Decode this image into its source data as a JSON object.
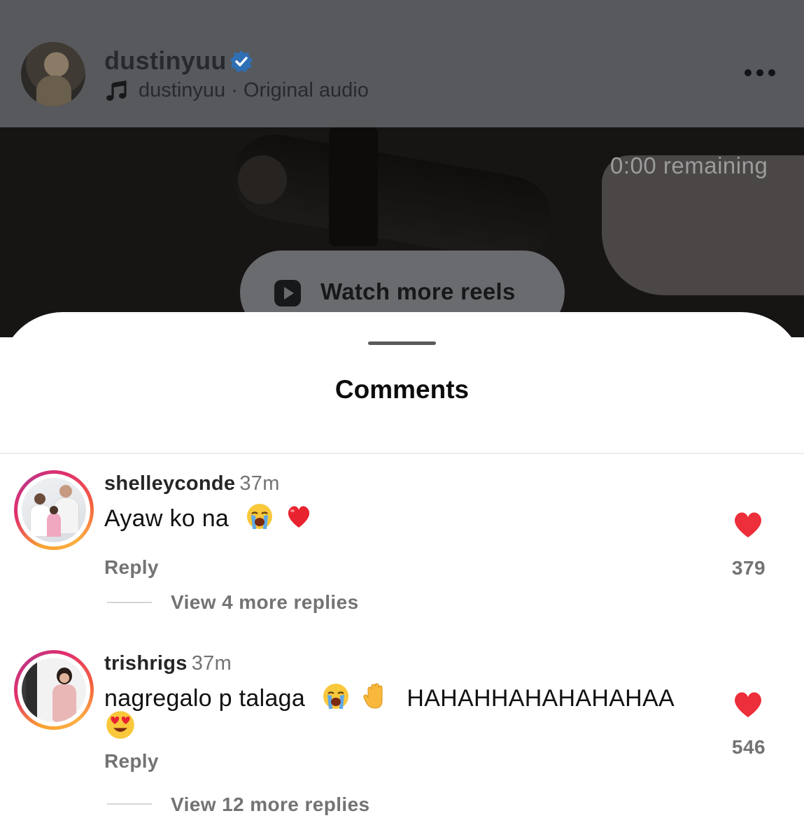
{
  "header": {
    "username": "dustinyuu",
    "audio_label": "dustinyuu · Original audio",
    "verified_icon": "verified-badge-icon",
    "more_icon": "more-horizontal-icon"
  },
  "video": {
    "remaining": "0:00 remaining",
    "watch_more_label": "Watch more reels",
    "watch_icon": "reels-play-icon"
  },
  "comments_sheet": {
    "title": "Comments",
    "comments": [
      {
        "username": "shelleyconde",
        "time": "37m",
        "text": "Ayaw ko na",
        "emojis": [
          "loudly-crying-face",
          "red-heart"
        ],
        "reply_label": "Reply",
        "likes": "379",
        "view_replies": "View 4 more replies"
      },
      {
        "username": "trishrigs",
        "time": "37m",
        "text_part1": "nagregalo p talaga",
        "text_part2": "HAHAHHAHAHAHAHAA",
        "emojis": [
          "loudly-crying-face",
          "raised-hand",
          "smiling-face-with-heart-eyes"
        ],
        "reply_label": "Reply",
        "likes": "546",
        "view_replies": "View 12 more replies"
      }
    ]
  },
  "colors": {
    "like_red": "#ed2f3b",
    "verified_blue": "#2f6fb4",
    "secondary_text": "#737373"
  }
}
